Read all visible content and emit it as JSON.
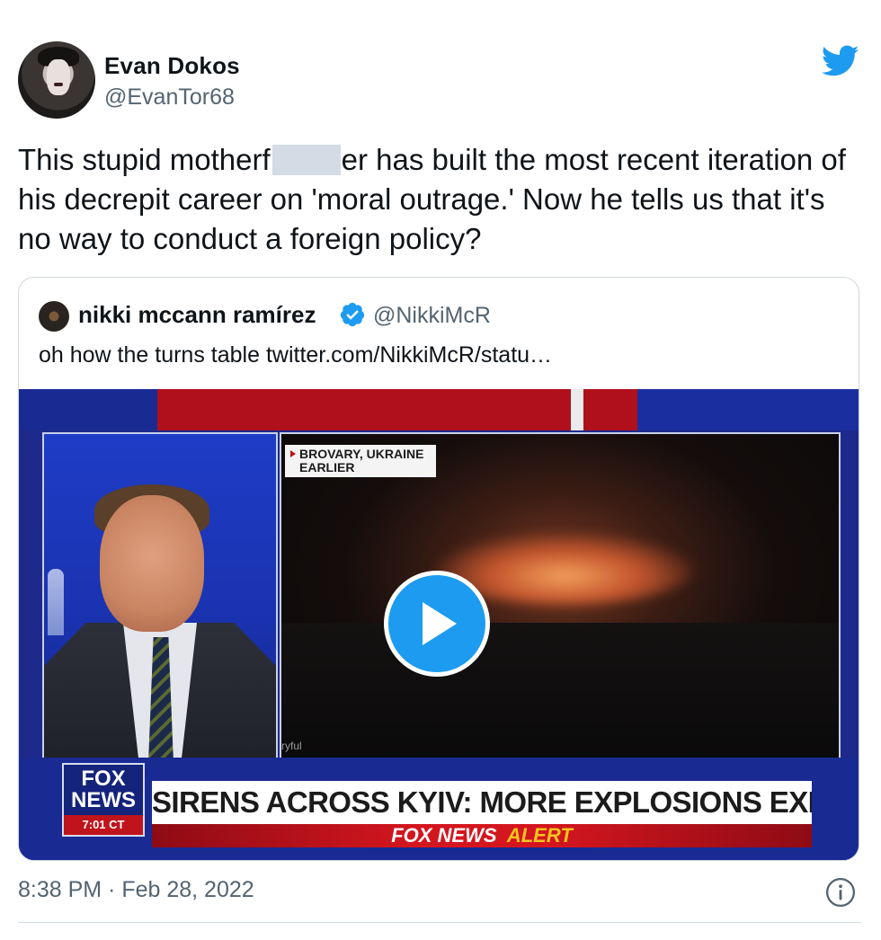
{
  "author": {
    "name": "Evan Dokos",
    "handle": "@EvanTor68"
  },
  "tweet": {
    "text_before_redaction": "This stupid motherf",
    "text_after_redaction": "er has built the most recent iteration of his decrepit career on 'moral outrage.' Now he tells us that it's no way to conduct a foreign policy?",
    "timestamp": "8:38 PM · Feb 28, 2022"
  },
  "quoted_tweet": {
    "name": "nikki mccann ramírez",
    "handle": "@NikkiMcR",
    "text": "oh how the turns table twitter.com/NikkiMcR/statu…",
    "video": {
      "location_line1": "BROVARY, UKRAINE",
      "location_line2": "EARLIER",
      "credit": "ryful",
      "logo_line1": "FOX",
      "logo_line2": "NEWS",
      "logo_time": "7:01 CT",
      "headline": "SIRENS ACROSS KYIV: MORE EXPLOSIONS EXPECTED",
      "alert_brand": "FOX NEWS",
      "alert_word": "ALERT"
    }
  },
  "icons": {
    "twitter_logo": "twitter-bird-icon",
    "verified": "verified-badge-icon",
    "play": "play-icon",
    "info": "info-icon"
  },
  "colors": {
    "twitter_blue": "#1d9bf0",
    "secondary_text": "#536471",
    "border": "#cfd9de"
  }
}
